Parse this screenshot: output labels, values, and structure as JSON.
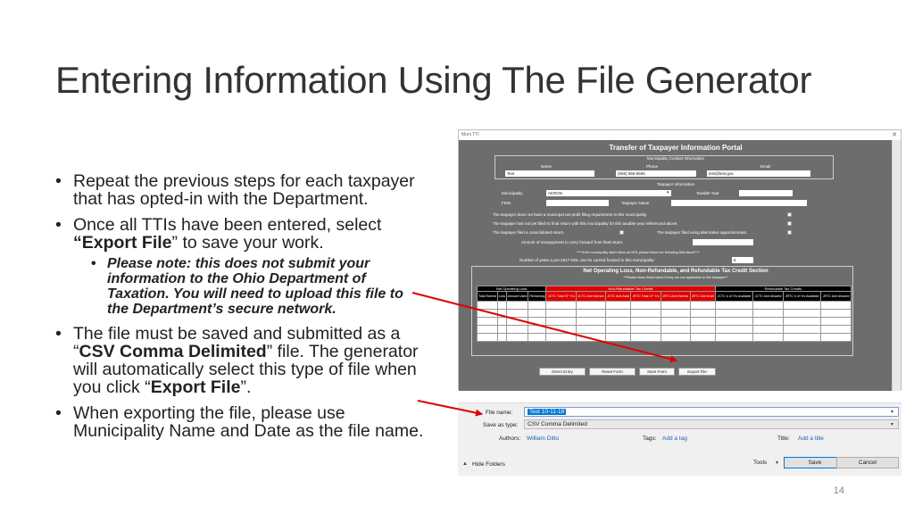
{
  "slide": {
    "title": "Entering Information Using The File Generator",
    "page_number": "14",
    "bullets": {
      "b1": "Repeat the previous steps for each taxpayer that has opted-in with the Department.",
      "b2_pre": "Once all TTIs have been entered, select ",
      "b2_bold": "“Export File",
      "b2_post": "” to save your work.",
      "sub": "Please note: this does not submit your information to the Ohio Department of Taxation.  You will need to upload this file to the Department’s secure network.",
      "b3_pre": "The file must be saved and submitted as a “",
      "b3_bold1": "CSV Comma Delimited",
      "b3_mid": "” file.  The generator will automatically select this type of file when you click “",
      "b3_bold2": "Export File",
      "b3_post": "”.",
      "b4": "When exporting the file, please use Municipality Name and Date as the file name."
    }
  },
  "tti_form": {
    "window_title": "Muni TTI",
    "title": "Transfer of Taxpayer Information Portal",
    "contact_heading": "Municipality Contact Information",
    "name_label": "Name",
    "phone_label": "Phone",
    "email_label": "Email",
    "name_value": "Test",
    "phone_value": "(555) 555-5555",
    "email_value": "test@test.gov",
    "taxpayer_heading": "Taxpayer Information",
    "municipality_label": "Municipality",
    "municipality_value": "AKRON",
    "taxable_year_label": "Taxable Year",
    "fein_label": "FEIN",
    "taxpayer_name_label": "Taxpayer Name",
    "q1": "The taxpayer does not have a municipal net profit filing requirement in this municipality.",
    "q2": "The taxpayer has not yet filed its final return with this municipality for this taxable year referenced above.",
    "q3": "The taxpayer filed a consolidated return.",
    "q4": "The taxpayer filed using alternative apportionment.",
    "overpayment_label": "Amount of overpayment to carry forward from final return:",
    "nol_note": "****If the municipality didn't allow an NOL please leave the following field blank****",
    "nol_label": "Number of years a pre-2017 NOL can be carried forward in this municipality:",
    "nol_value": "5",
    "section_title": "Net Operating Loss, Non-Refundable, and Refundable Tax Credit Section",
    "section_note": "**Please leave fields blank if they are not applicable to this taxpayer**",
    "group_nol": "Net Operating Loss",
    "group_nonref": "Non-Refundable Tax Credits",
    "group_ref": "Refundable Tax Credits",
    "columns": [
      "Total Earned",
      "Loss",
      "Amount Used",
      "Remaining",
      "JCTC Total CF Yrs",
      "JCTC Amt Earned",
      "JCTC Amt Avail",
      "JRTC Total CF Yrs",
      "JRTC Amt Earned",
      "JRTC Amt Avail",
      "JCTC # of Yrs Available",
      "JCTC Amt Allowed",
      "JRTC # of Yrs Available",
      "JRTC Amt Allowed"
    ],
    "buttons": {
      "direct_entry": "Direct Entry",
      "reset_form": "Reset Form",
      "save_form": "Save Form",
      "export_file": "Export File"
    }
  },
  "save_dialog": {
    "file_name_label": "File name:",
    "file_name_value": "Test 10-11-18",
    "save_type_label": "Save as type:",
    "save_type_value": "CSV Comma Delimited",
    "authors_label": "Authors:",
    "authors_value": "William Ditto",
    "tags_label": "Tags:",
    "tags_value": "Add a tag",
    "title_label": "Title:",
    "title_value": "Add a title",
    "hide_folders": "Hide Folders",
    "tools_label": "Tools",
    "save_button": "Save",
    "cancel_button": "Cancel"
  },
  "colors": {
    "accent_red": "#e00000",
    "form_gray": "#6d6d6d",
    "arrow": "#e00000"
  }
}
